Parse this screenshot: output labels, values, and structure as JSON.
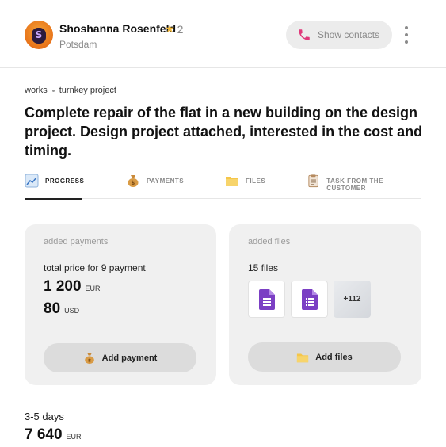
{
  "user": {
    "name": "Shoshanna Rosenfeld",
    "avatar_letter": "S",
    "rating": "2",
    "city": "Potsdam",
    "show_contacts_label": "Show contacts"
  },
  "breadcrumb": [
    "works",
    "turnkey project"
  ],
  "title": "Complete repair of the flat in a new building on the design project. Design project attached, interested in the cost and timing.",
  "tabs": [
    {
      "label": "PROGRESS",
      "icon": "chart-icon",
      "active": true
    },
    {
      "label": "PAYMENTS",
      "icon": "money-bag-icon",
      "active": false
    },
    {
      "label": "FILES",
      "icon": "folder-icon",
      "active": false
    },
    {
      "label": "TASK FROM THE CUSTOMER",
      "icon": "clipboard-icon",
      "active": false
    }
  ],
  "payments_card": {
    "caption": "added payments",
    "summary": "total price for 9 payment",
    "amounts": [
      {
        "value": "1 200",
        "currency": "EUR"
      },
      {
        "value": "80",
        "currency": "USD"
      }
    ],
    "button_label": "Add payment"
  },
  "files_card": {
    "caption": "added files",
    "summary": "15 files",
    "more_count": "+112",
    "button_label": "Add files"
  },
  "estimate": {
    "duration": "3-5 days",
    "total_value": "7 640",
    "total_currency": "EUR"
  },
  "colors": {
    "accent_phone": "#e0397b",
    "star": "#f2b93b",
    "doc_purple": "#7b3fc4",
    "card_bg": "#f0f0f0"
  }
}
